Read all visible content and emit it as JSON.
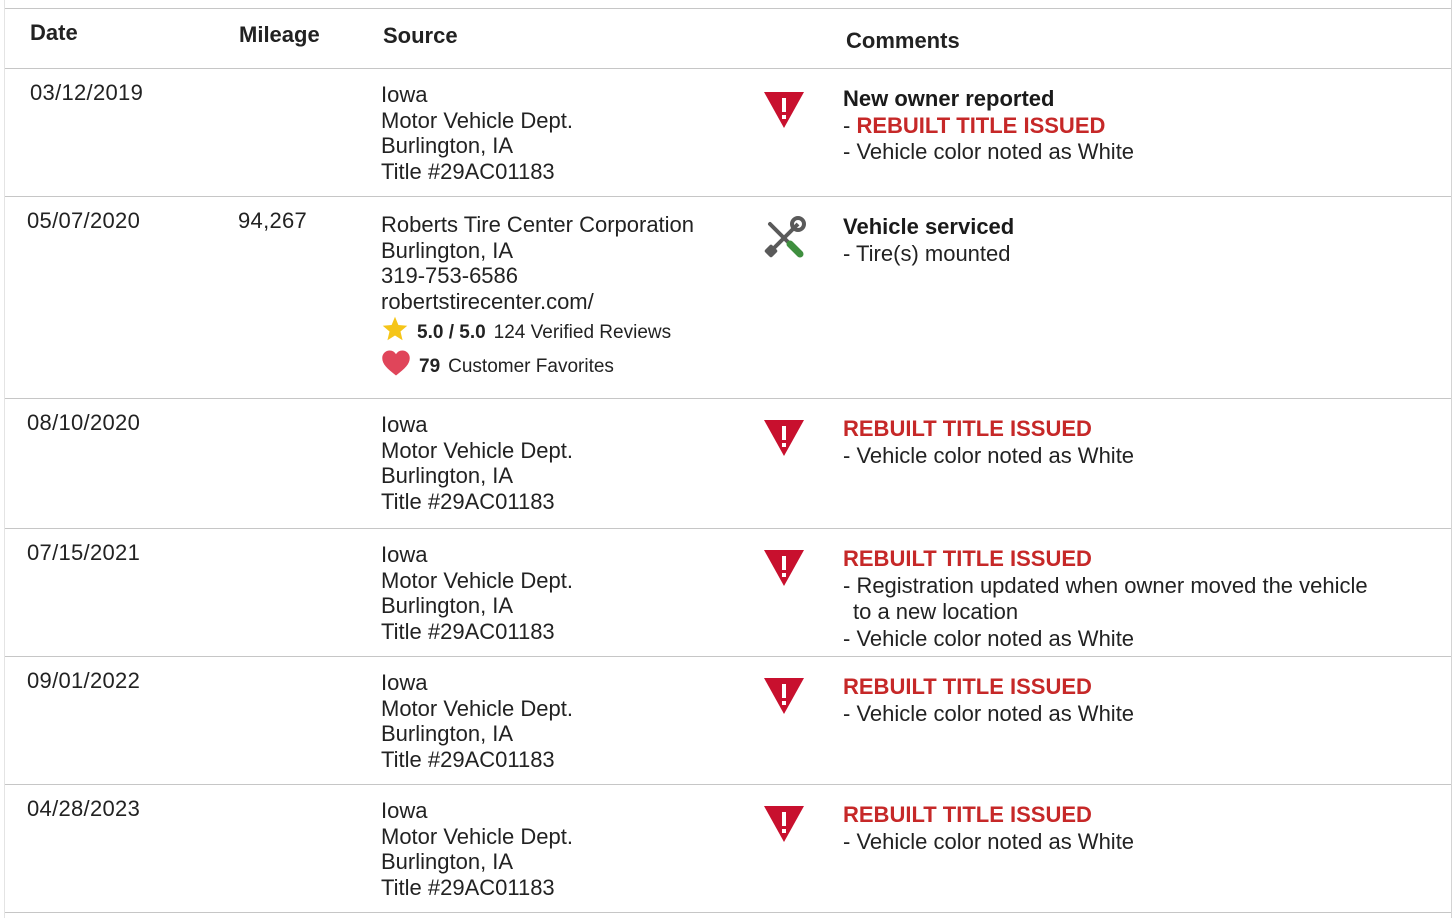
{
  "headers": {
    "date": "Date",
    "mileage": "Mileage",
    "source": "Source",
    "comments": "Comments"
  },
  "icons": {
    "warning": "warning-triangle-icon",
    "service": "wrench-screwdriver-icon",
    "star": "star-icon",
    "heart": "heart-icon"
  },
  "colors": {
    "alert_red": "#c62828",
    "icon_red": "#c8102e",
    "star_gold": "#f5c518",
    "heart_red": "#e0455a",
    "tool_green": "#3f8f3f"
  },
  "records": [
    {
      "date": "03/12/2019",
      "mileage": "",
      "source": [
        "Iowa",
        "Motor Vehicle Dept.",
        "Burlington, IA",
        "Title #29AC01183"
      ],
      "headline": "New owner reported",
      "alert_prefix": "- ",
      "alert": "REBUILT TITLE ISSUED",
      "items": [
        "- Vehicle color noted as White"
      ]
    },
    {
      "date": "05/07/2020",
      "mileage": "94,267",
      "source": [
        "Roberts Tire Center Corporation",
        "Burlington, IA",
        "319-753-6586",
        "robertstirecenter.com/"
      ],
      "rating_score": "5.0 / 5.0",
      "rating_reviews": "124 Verified Reviews",
      "favorites_count": "79",
      "favorites_label": "Customer Favorites",
      "headline": "Vehicle serviced",
      "items": [
        "- Tire(s) mounted"
      ]
    },
    {
      "date": "08/10/2020",
      "mileage": "",
      "source": [
        "Iowa",
        "Motor Vehicle Dept.",
        "Burlington, IA",
        "Title #29AC01183"
      ],
      "alert": "REBUILT TITLE ISSUED",
      "items": [
        "- Vehicle color noted as White"
      ]
    },
    {
      "date": "07/15/2021",
      "mileage": "",
      "source": [
        "Iowa",
        "Motor Vehicle Dept.",
        "Burlington, IA",
        "Title #29AC01183"
      ],
      "alert": "REBUILT TITLE ISSUED",
      "items": [
        "- Registration updated when owner moved the vehicle",
        "to a new location",
        "- Vehicle color noted as White"
      ]
    },
    {
      "date": "09/01/2022",
      "mileage": "",
      "source": [
        "Iowa",
        "Motor Vehicle Dept.",
        "Burlington, IA",
        "Title #29AC01183"
      ],
      "alert": "REBUILT TITLE ISSUED",
      "items": [
        "- Vehicle color noted as White"
      ]
    },
    {
      "date": "04/28/2023",
      "mileage": "",
      "source": [
        "Iowa",
        "Motor Vehicle Dept.",
        "Burlington, IA",
        "Title #29AC01183"
      ],
      "alert": "REBUILT TITLE ISSUED",
      "items": [
        "- Vehicle color noted as White"
      ]
    }
  ]
}
